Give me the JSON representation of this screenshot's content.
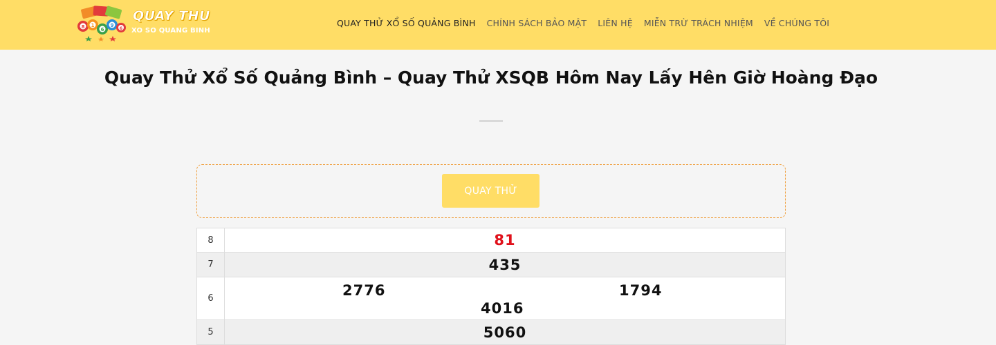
{
  "header": {
    "logo": {
      "title": "QUAY THU",
      "subtitle": "XO SO QUANG BINH",
      "ball_numbers": [
        "8",
        "1",
        "6",
        "9",
        "6"
      ]
    },
    "nav": [
      {
        "label": "QUAY THỬ XỔ SỐ QUẢNG BÌNH",
        "active": true
      },
      {
        "label": "CHÍNH SÁCH BẢO MẬT",
        "active": false
      },
      {
        "label": "LIÊN HỆ",
        "active": false
      },
      {
        "label": "MIỄN TRỪ TRÁCH NHIỆM",
        "active": false
      },
      {
        "label": "VỀ CHÚNG TÔI",
        "active": false
      }
    ]
  },
  "main": {
    "title": "Quay Thử Xổ Số Quảng Bình – Quay Thử XSQB Hôm Nay Lấy Hên Giờ Hoàng Đạo",
    "spin_button_label": "QUAY THỬ"
  },
  "results": [
    {
      "prize": "8",
      "numbers": [
        "81"
      ],
      "highlight": true
    },
    {
      "prize": "7",
      "numbers": [
        "435"
      ]
    },
    {
      "prize": "6",
      "numbers": [
        "2776",
        "1794",
        "4016"
      ]
    },
    {
      "prize": "5",
      "numbers": [
        "5060"
      ]
    }
  ],
  "colors": {
    "header_bg": "#ffdd66",
    "button_bg": "#ffdd66",
    "highlight_number": "#e0111b",
    "page_bg": "#f5f5f5"
  }
}
